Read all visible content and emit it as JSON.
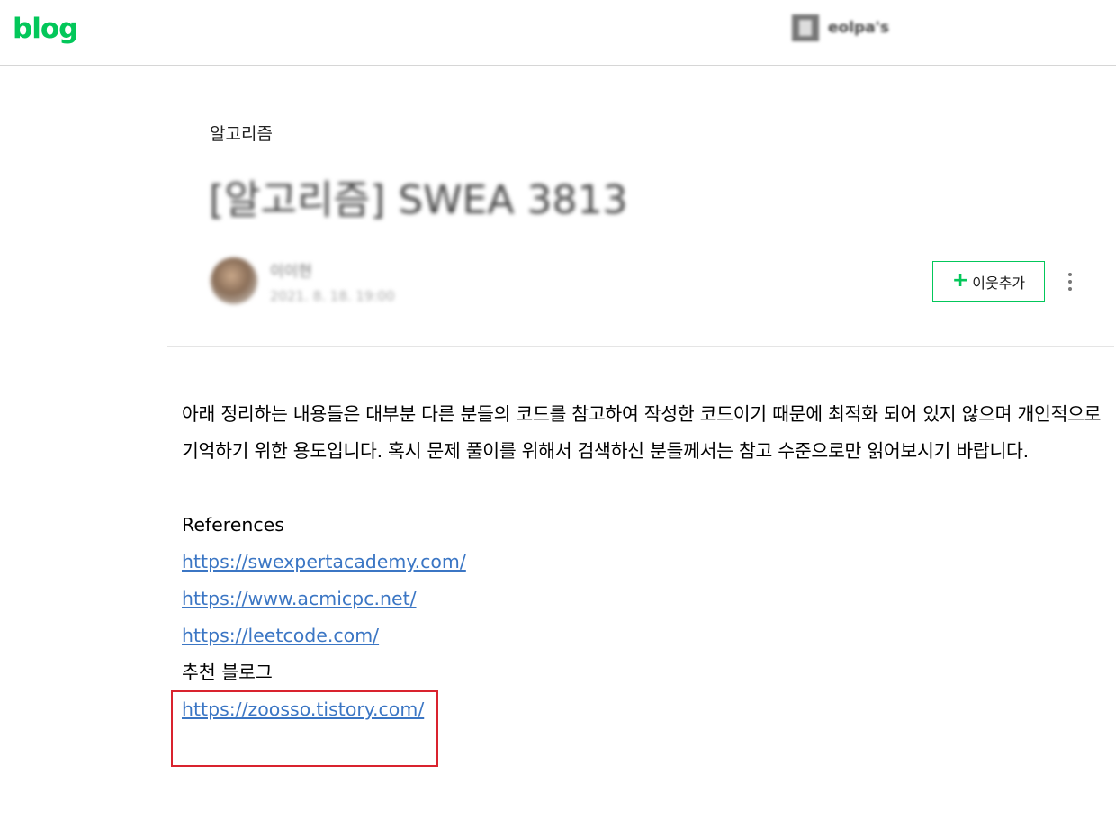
{
  "header": {
    "logo": "blog",
    "blog_owner": "eolpa's"
  },
  "post": {
    "category": "알고리즘",
    "title": "[알고리즘] SWEA 3813",
    "author_name": "이이현",
    "date": "2021. 8. 18. 19:00",
    "add_neighbor_label": "이웃추가",
    "more_icon": "more-vertical-icon"
  },
  "content": {
    "intro": "아래 정리하는 내용들은 대부분 다른 분들의 코드를 참고하여 작성한 코드이기 때문에 최적화 되어 있지 않으며 개인적으로 기억하기 위한 용도입니다. 혹시 문제 풀이를 위해서 검색하신 분들께서는 참고 수준으로만 읽어보시기 바랍니다.",
    "references_heading": "References",
    "references": [
      "https://swexpertacademy.com/",
      "https://www.acmicpc.net/",
      "https://leetcode.com/"
    ],
    "recommended_heading": "추천 블로그",
    "recommended_link": "https://zoosso.tistory.com/"
  },
  "colors": {
    "brand": "#03c75a",
    "link": "#3b76c4",
    "highlight_border": "#d9232e"
  }
}
